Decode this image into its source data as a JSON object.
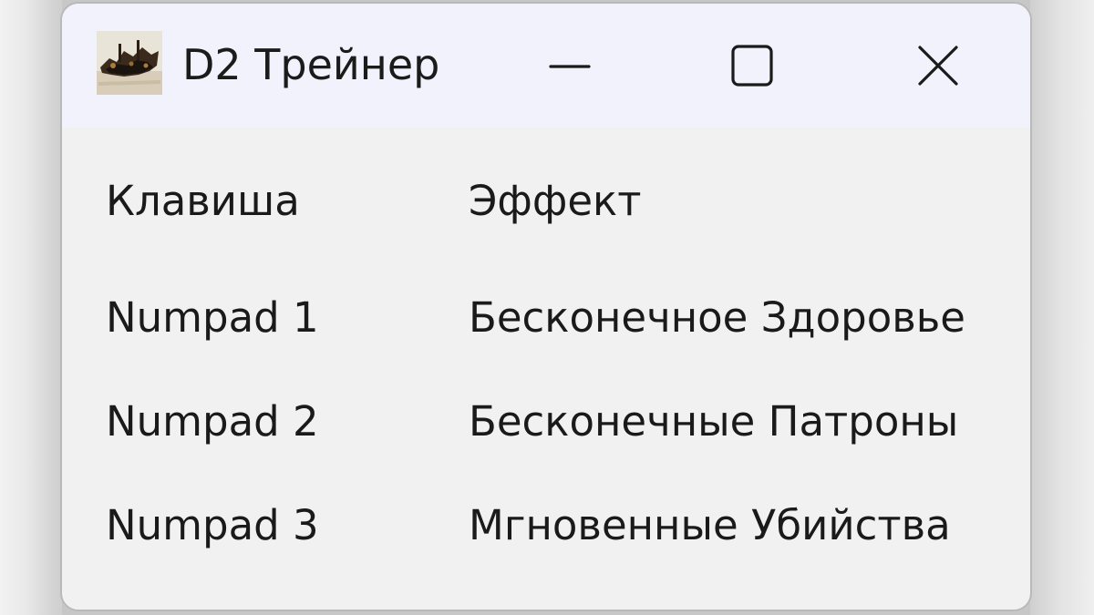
{
  "window": {
    "title": "D2 Трейнер",
    "icon": "app-icon-ship",
    "controls": {
      "minimize": "minimize-icon",
      "maximize": "maximize-icon",
      "close": "close-icon"
    }
  },
  "table": {
    "headers": {
      "key": "Клавиша",
      "effect": "Эффект"
    },
    "rows": [
      {
        "key": "Numpad 1",
        "effect": "Бесконечное Здоровье"
      },
      {
        "key": "Numpad 2",
        "effect": "Бесконечные Патроны"
      },
      {
        "key": "Numpad 3",
        "effect": "Мгновенные Убийства"
      }
    ]
  },
  "colors": {
    "titlebar_bg": "#f1f2fb",
    "window_bg": "#f1f1f1",
    "text": "#1a1a1a",
    "border": "#b9b9b9"
  }
}
